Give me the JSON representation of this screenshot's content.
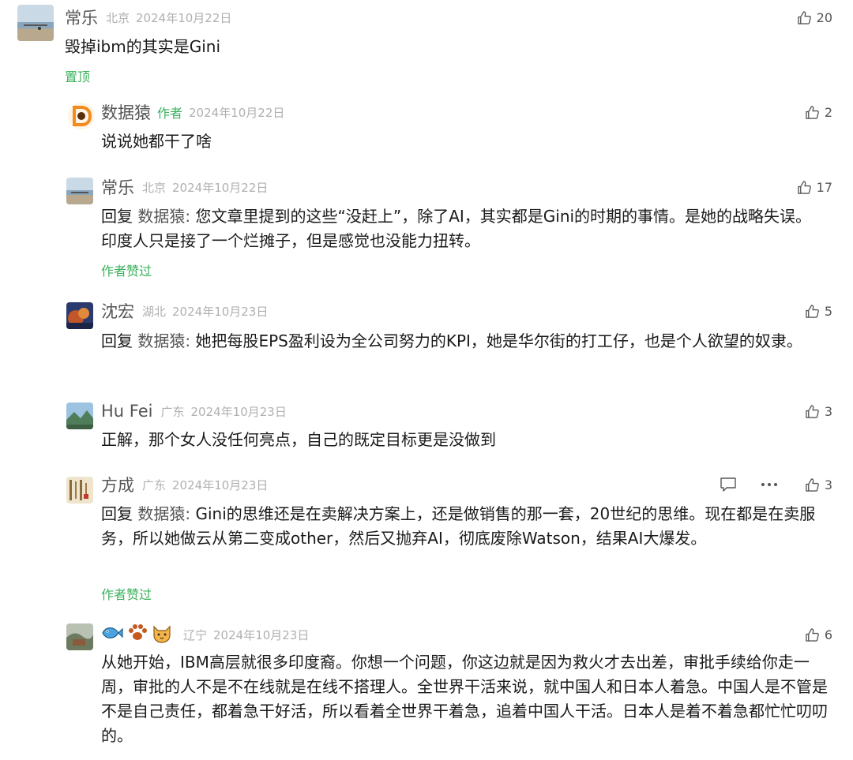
{
  "comments": [
    {
      "nick": "常乐",
      "location": "北京",
      "date": "2024年10月22日",
      "likes": "20",
      "text": "毁掉ibm的其实是Gini",
      "badge": "置顶"
    },
    {
      "nick": "数据猿",
      "author_tag": "作者",
      "date": "2024年10月22日",
      "likes": "2",
      "text": "说说她都干了啥"
    },
    {
      "nick": "常乐",
      "location": "北京",
      "date": "2024年10月22日",
      "likes": "17",
      "reply_prefix": "回复",
      "reply_to": "数据猿:",
      "text": " 您文章里提到的这些“没赶上”，除了AI，其实都是Gini的时期的事情。是她的战略失误。印度人只是接了一个烂摊子，但是感觉也没能力扭转。",
      "badge": "作者赞过"
    },
    {
      "nick": "沈宏",
      "location": "湖北",
      "date": "2024年10月23日",
      "likes": "5",
      "reply_prefix": "回复",
      "reply_to": "数据猿:",
      "text": " 她把每股EPS盈利设为全公司努力的KPI，她是华尔街的打工仔，也是个人欲望的奴隶。"
    },
    {
      "nick": "Hu Fei",
      "location": "广东",
      "date": "2024年10月23日",
      "likes": "3",
      "text": "正解，那个女人没任何亮点，自己的既定目标更是没做到"
    },
    {
      "nick": "方成",
      "location": "广东",
      "date": "2024年10月23日",
      "likes": "3",
      "reply_prefix": "回复",
      "reply_to": "数据猿:",
      "text": " Gini的思维还是在卖解决方案上，还是做销售的那一套，20世纪的思维。现在都是在卖服务，所以她做云从第二变成other，然后又抛弃AI，彻底废除Watson，结果AI大爆发。",
      "badge": "作者赞过"
    },
    {
      "nick_icons": [
        "fish-icon",
        "paw-icon",
        "cat-icon"
      ],
      "location": "辽宁",
      "date": "2024年10月23日",
      "likes": "6",
      "text": "从她开始，IBM高层就很多印度裔。你想一个问题，你这边就是因为救火才去出差，审批手续给你走一周，审批的人不是不在线就是在线不搭理人。全世界干活来说，就中国人和日本人着急。中国人是不管是不是自己责任，都着急干好活，所以看着全世界干着急，追着中国人干活。日本人是着不着急都忙忙叨叨的。"
    }
  ]
}
